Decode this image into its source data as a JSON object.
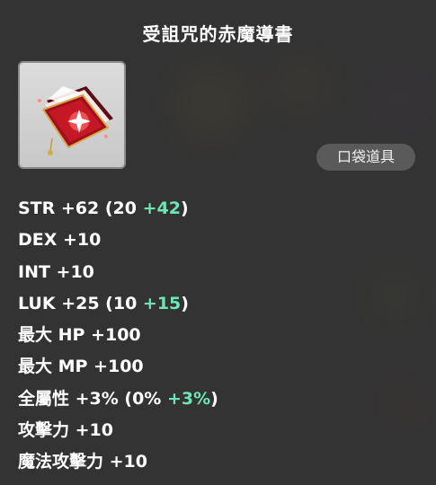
{
  "item": {
    "name": "受詛咒的赤魔導書",
    "category_badge": "口袋道具",
    "icon": "cursed-red-grimoire-icon"
  },
  "stats": [
    {
      "label": "STR +62 (20 ",
      "bonus": "+42",
      "tail": ")"
    },
    {
      "label": "DEX +10"
    },
    {
      "label": "INT +10"
    },
    {
      "label": "LUK +25 (10 ",
      "bonus": "+15",
      "tail": ")"
    },
    {
      "label": "最大 HP +100"
    },
    {
      "label": "最大 MP +100"
    },
    {
      "label": "全屬性 +3% (0% ",
      "bonus": "+3%",
      "tail": ")"
    },
    {
      "label": "攻擊力 +10"
    },
    {
      "label": "魔法攻擊力 +10"
    }
  ],
  "colors": {
    "bonus": "#6ee6b4",
    "text": "#ffffff",
    "panel": "#323232"
  }
}
